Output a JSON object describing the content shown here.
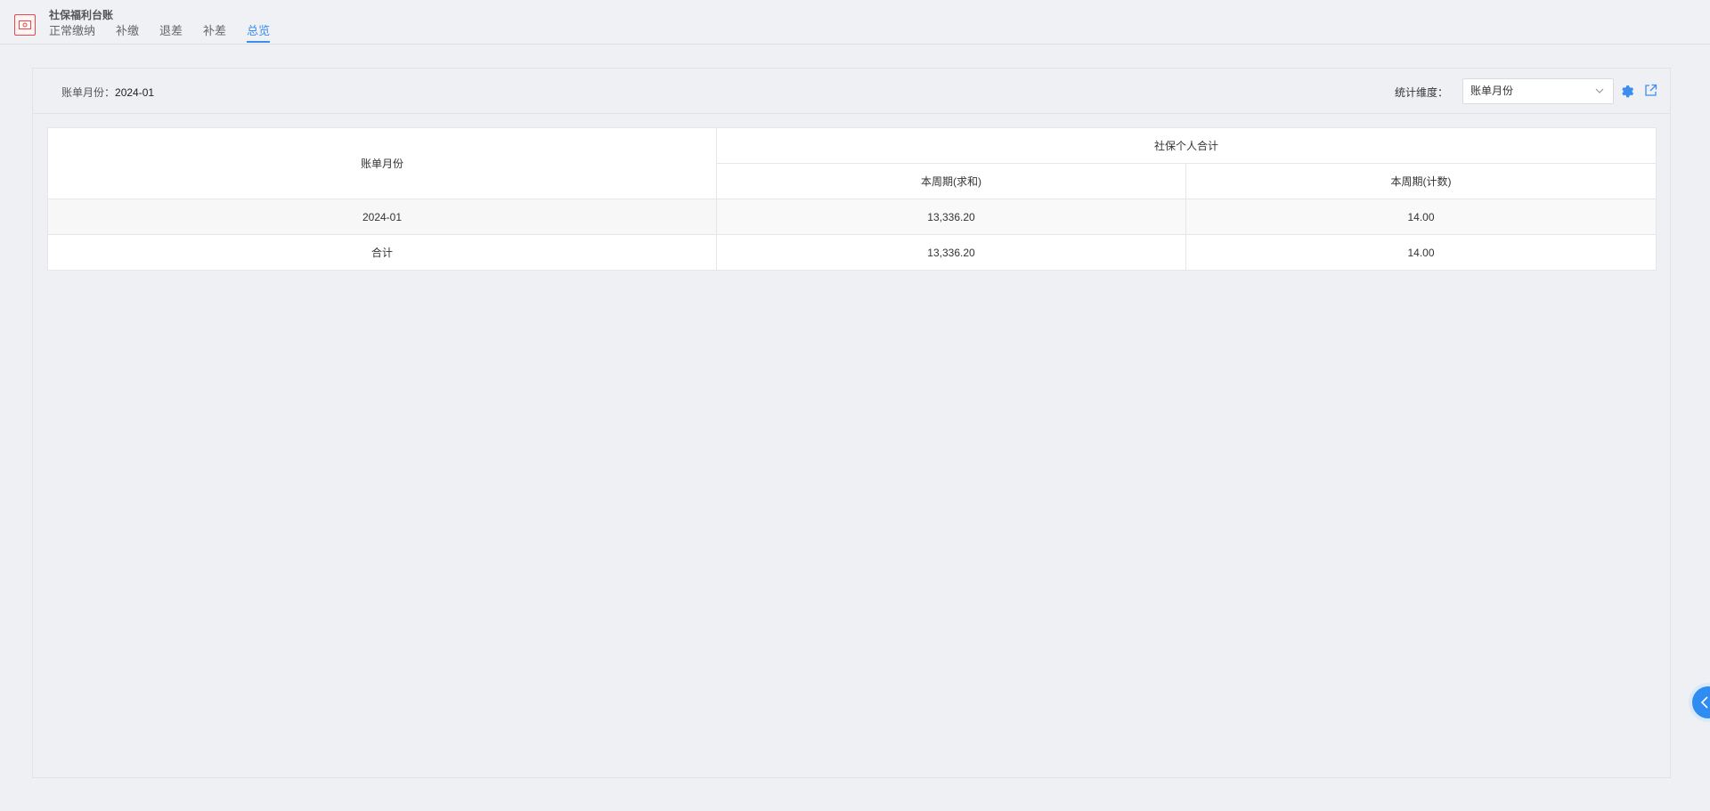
{
  "header": {
    "title": "社保福利台账",
    "tabs": [
      {
        "label": "正常缴纳",
        "active": false
      },
      {
        "label": "补缴",
        "active": false
      },
      {
        "label": "退差",
        "active": false
      },
      {
        "label": "补差",
        "active": false
      },
      {
        "label": "总览",
        "active": true
      }
    ]
  },
  "filter": {
    "bill_month_label": "账单月份：",
    "bill_month_value": "2024-01",
    "dimension_label": "统计维度：",
    "dimension_value": "账单月份"
  },
  "table": {
    "row_header": "账单月份",
    "group_header": "社保个人合计",
    "sub_headers": [
      "本周期(求和)",
      "本周期(计数)"
    ],
    "rows": [
      {
        "month": "2024-01",
        "sum": "13,336.20",
        "count": "14.00"
      },
      {
        "month": "合计",
        "sum": "13,336.20",
        "count": "14.00"
      }
    ]
  },
  "colors": {
    "accent": "#3b8ef0",
    "app_icon": "#e8484b",
    "background": "#eff0f4"
  },
  "icons": {
    "app": "ledger-icon",
    "settings": "gear-icon",
    "export": "external-link-icon",
    "select": "chevron-down-icon",
    "float": "chevron-left-icon"
  }
}
